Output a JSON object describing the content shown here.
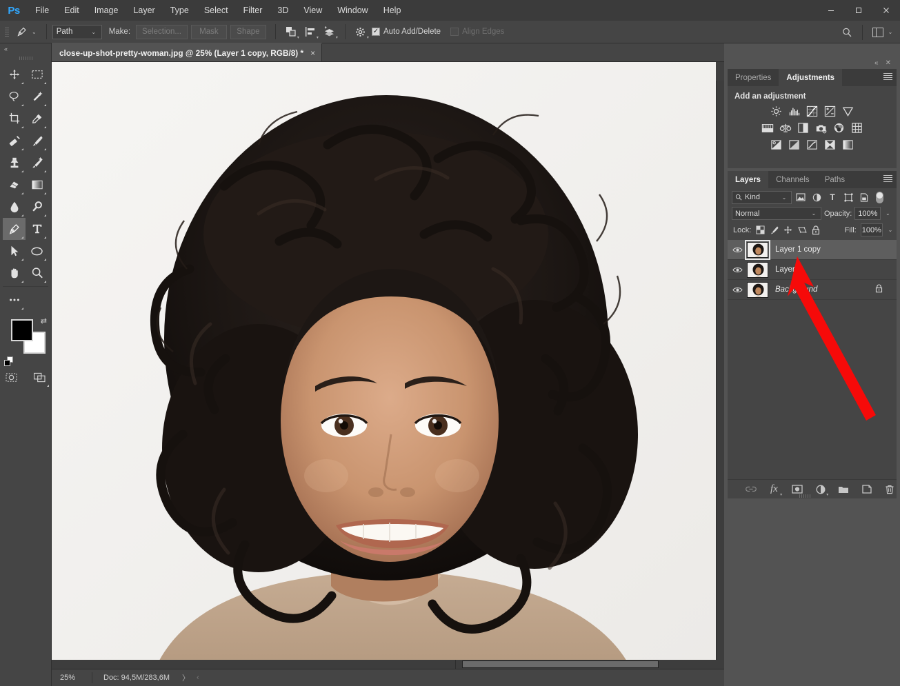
{
  "app": {
    "logo": "Ps",
    "menus": [
      "File",
      "Edit",
      "Image",
      "Layer",
      "Type",
      "Select",
      "Filter",
      "3D",
      "View",
      "Window",
      "Help"
    ],
    "window_controls": [
      {
        "name": "minimize",
        "glyph": "—"
      },
      {
        "name": "maximize",
        "glyph": "❐"
      },
      {
        "name": "close",
        "glyph": "✕"
      }
    ]
  },
  "options_bar": {
    "tool_icon": "pen-tool-icon",
    "mode_select": {
      "value": "Path",
      "caret": "⌄"
    },
    "make_label": "Make:",
    "buttons": [
      "Selection...",
      "Mask",
      "Shape"
    ],
    "path_ops_icon": "path-operations-icon",
    "path_align_icon": "path-alignment-icon",
    "path_arrange_icon": "path-arrangement-icon",
    "gear_icon": "gear-icon",
    "auto_add_delete": {
      "label": "Auto Add/Delete",
      "checked": true
    },
    "align_edges": {
      "label": "Align Edges",
      "checked": false,
      "disabled": true
    },
    "search_icon": "search-icon",
    "workspace_icon": "workspace-switcher-icon",
    "workspace_caret": "⌄"
  },
  "toolbar": {
    "collapse_glyph": "«",
    "tools": [
      {
        "name": "move-tool",
        "glyph": "✥",
        "active": false
      },
      {
        "name": "rectangular-marquee-tool",
        "glyph": "⬚",
        "active": false
      },
      {
        "name": "lasso-tool",
        "glyph": "○",
        "active": false
      },
      {
        "name": "magic-wand-tool",
        "glyph": "✧",
        "active": false
      },
      {
        "name": "crop-tool",
        "glyph": "⌙",
        "active": false
      },
      {
        "name": "eyedropper-tool",
        "glyph": "✐",
        "active": false
      },
      {
        "name": "spot-healing-brush-tool",
        "glyph": "✇",
        "active": false
      },
      {
        "name": "brush-tool",
        "glyph": "✒",
        "active": false
      },
      {
        "name": "clone-stamp-tool",
        "glyph": "⚑",
        "active": false
      },
      {
        "name": "history-brush-tool",
        "glyph": "✎",
        "active": false
      },
      {
        "name": "eraser-tool",
        "glyph": "◢",
        "active": false
      },
      {
        "name": "gradient-tool",
        "glyph": "▤",
        "active": false
      },
      {
        "name": "blur-tool",
        "glyph": "●",
        "active": false
      },
      {
        "name": "dodge-tool",
        "glyph": "⚲",
        "active": false
      },
      {
        "name": "pen-tool",
        "glyph": "✑",
        "active": true
      },
      {
        "name": "horizontal-type-tool",
        "glyph": "T",
        "active": false
      },
      {
        "name": "path-selection-tool",
        "glyph": "➤",
        "active": false
      },
      {
        "name": "ellipse-tool",
        "glyph": "⬭",
        "active": false
      },
      {
        "name": "hand-tool",
        "glyph": "✋",
        "active": false
      },
      {
        "name": "zoom-tool",
        "glyph": "⚲",
        "active": false
      },
      {
        "name": "edit-toolbar-tool",
        "glyph": "⋯",
        "active": false
      }
    ],
    "foreground_color": "#000000",
    "background_color": "#ffffff",
    "quick_mask_icon": "quick-mask-icon",
    "screen_mode_icon": "screen-mode-icon"
  },
  "document": {
    "tab_title": "close-up-shot-pretty-woman.jpg @ 25% (Layer 1 copy, RGB/8) *",
    "close_glyph": "×"
  },
  "status_bar": {
    "zoom": "25%",
    "doc_info": "Doc: 94,5M/283,6M",
    "arrow_right": "〉",
    "arrow_left": "‹"
  },
  "adjustments_panel": {
    "collapse_glyph": "«",
    "close_glyph": "✕",
    "tabs": [
      {
        "label": "Properties",
        "active": false
      },
      {
        "label": "Adjustments",
        "active": true
      }
    ],
    "title": "Add an adjustment",
    "rows": [
      [
        {
          "name": "brightness-contrast-icon",
          "glyph": "☀"
        },
        {
          "name": "levels-icon",
          "glyph": "ᵛ"
        },
        {
          "name": "curves-icon",
          "glyph": "⧉"
        },
        {
          "name": "exposure-icon",
          "glyph": "±"
        },
        {
          "name": "vibrance-icon",
          "glyph": "▽"
        }
      ],
      [
        {
          "name": "hue-saturation-icon",
          "glyph": "▥"
        },
        {
          "name": "color-balance-icon",
          "glyph": "⚖"
        },
        {
          "name": "black-white-icon",
          "glyph": "◑"
        },
        {
          "name": "photo-filter-icon",
          "glyph": "♁"
        },
        {
          "name": "channel-mixer-icon",
          "glyph": "◎"
        },
        {
          "name": "color-lookup-icon",
          "glyph": "⌗"
        }
      ],
      [
        {
          "name": "invert-icon",
          "glyph": "◨"
        },
        {
          "name": "posterize-icon",
          "glyph": "◫"
        },
        {
          "name": "threshold-icon",
          "glyph": "↗"
        },
        {
          "name": "selective-color-icon",
          "glyph": "⋈"
        },
        {
          "name": "gradient-map-icon",
          "glyph": "▨"
        }
      ]
    ]
  },
  "layers_panel": {
    "tabs": [
      {
        "label": "Layers",
        "active": true
      },
      {
        "label": "Channels",
        "active": false
      },
      {
        "label": "Paths",
        "active": false
      }
    ],
    "filter": {
      "search_icon": "search-icon",
      "kind_value": "Kind",
      "caret": "⌄",
      "type_filters": [
        {
          "name": "filter-pixel-icon",
          "glyph": "⛰"
        },
        {
          "name": "filter-adjustment-icon",
          "glyph": "◑"
        },
        {
          "name": "filter-type-icon",
          "glyph": "T"
        },
        {
          "name": "filter-shape-icon",
          "glyph": "⬚"
        },
        {
          "name": "filter-smart-object-icon",
          "glyph": "❐"
        }
      ],
      "toggle_name": "filter-enable-toggle"
    },
    "blend_mode": "Normal",
    "opacity_label": "Opacity:",
    "opacity_value": "100%",
    "lock_label": "Lock:",
    "lock_icons": [
      {
        "name": "lock-transparent-pixels-icon",
        "glyph": "▒"
      },
      {
        "name": "lock-image-pixels-icon",
        "glyph": "✒"
      },
      {
        "name": "lock-position-icon",
        "glyph": "✥"
      },
      {
        "name": "lock-artboard-nesting-icon",
        "glyph": "⧉"
      },
      {
        "name": "lock-all-icon",
        "glyph": "ὑ2"
      }
    ],
    "fill_label": "Fill:",
    "fill_value": "100%",
    "layers": [
      {
        "name": "Layer 1 copy",
        "visible": true,
        "selected": true,
        "locked": false,
        "italic": false
      },
      {
        "name": "Layer 1",
        "visible": true,
        "selected": false,
        "locked": false,
        "italic": false
      },
      {
        "name": "Background",
        "visible": true,
        "selected": false,
        "locked": true,
        "italic": true
      }
    ],
    "footer_icons": [
      {
        "name": "link-layers-icon",
        "glyph": "⚭",
        "dim": true
      },
      {
        "name": "layer-style-fx-icon",
        "glyph": "fx",
        "dim": false
      },
      {
        "name": "add-layer-mask-icon",
        "glyph": "▣",
        "dim": false
      },
      {
        "name": "new-fill-adjustment-layer-icon",
        "glyph": "◑",
        "dim": false
      },
      {
        "name": "new-group-icon",
        "glyph": "▱",
        "dim": false
      },
      {
        "name": "new-layer-icon",
        "glyph": "⧉",
        "dim": false
      },
      {
        "name": "delete-layer-icon",
        "glyph": "Ὕ1",
        "dim": false
      }
    ]
  },
  "annotation": {
    "arrow_color": "#f60a09",
    "name": "red-annotation-arrow"
  }
}
